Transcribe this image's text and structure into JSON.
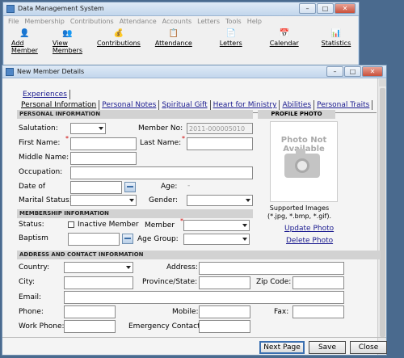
{
  "main_window": {
    "title": "Data Management System",
    "menu": [
      "File",
      "Membership",
      "Contributions",
      "Attendance",
      "Accounts",
      "Letters",
      "Tools",
      "Help"
    ],
    "toolbar": [
      {
        "label": "Add Member",
        "icon": "add-member-icon",
        "glyph": "👤"
      },
      {
        "label": "View Members",
        "icon": "view-members-icon",
        "glyph": "👥"
      },
      {
        "label": "Contributions",
        "icon": "contributions-icon",
        "glyph": "💰"
      },
      {
        "label": "Attendance",
        "icon": "attendance-icon",
        "glyph": "📋"
      },
      {
        "label": "Letters",
        "icon": "letters-icon",
        "glyph": "📄"
      },
      {
        "label": "Calendar",
        "icon": "calendar-icon",
        "glyph": "📅"
      },
      {
        "label": "Statistics",
        "icon": "statistics-icon",
        "glyph": "📊"
      }
    ]
  },
  "dialog": {
    "title": "New Member Details",
    "tabs_row1": [
      "Experiences"
    ],
    "tabs_row2": [
      "Personal Information",
      "Personal Notes",
      "Spiritual Gift",
      "Heart for Ministry",
      "Abilities",
      "Personal Traits"
    ],
    "personal": {
      "heading": "PERSONAL INFORMATION",
      "salutation": "Salutation:",
      "member_no": "Member No:",
      "member_no_value": "2011-000005010",
      "first_name": "First Name:",
      "last_name": "Last Name:",
      "middle_name": "Middle Name:",
      "occupation": "Occupation:",
      "date_of": "Date of",
      "age": "Age:",
      "age_value": "-",
      "marital_status": "Marital Status:",
      "gender": "Gender:"
    },
    "photo": {
      "heading": "PROFILE PHOTO",
      "placeholder": "Photo Not Available",
      "supported": "Supported Images (*.jpg, *.bmp, *.gif).",
      "update": "Update Photo",
      "delete": "Delete Photo"
    },
    "membership": {
      "heading": "MEMBERSHIP INFORMATION",
      "status": "Status:",
      "inactive": "Inactive Member",
      "member": "Member",
      "baptism": "Baptism",
      "age_group": "Age Group:"
    },
    "address": {
      "heading": "ADDRESS AND CONTACT INFORMATION",
      "country": "Country:",
      "address": "Address:",
      "city": "City:",
      "province": "Province/State:",
      "zip": "Zip Code:",
      "email": "Email:",
      "phone": "Phone:",
      "mobile": "Mobile:",
      "fax": "Fax:",
      "work_phone": "Work Phone:",
      "emergency": "Emergency Contact:"
    },
    "buttons": {
      "next": "Next Page",
      "save": "Save",
      "close": "Close"
    }
  },
  "colors": {
    "accent": "#3b6fb0",
    "link": "#1a1a8f",
    "required": "#cc0000"
  }
}
